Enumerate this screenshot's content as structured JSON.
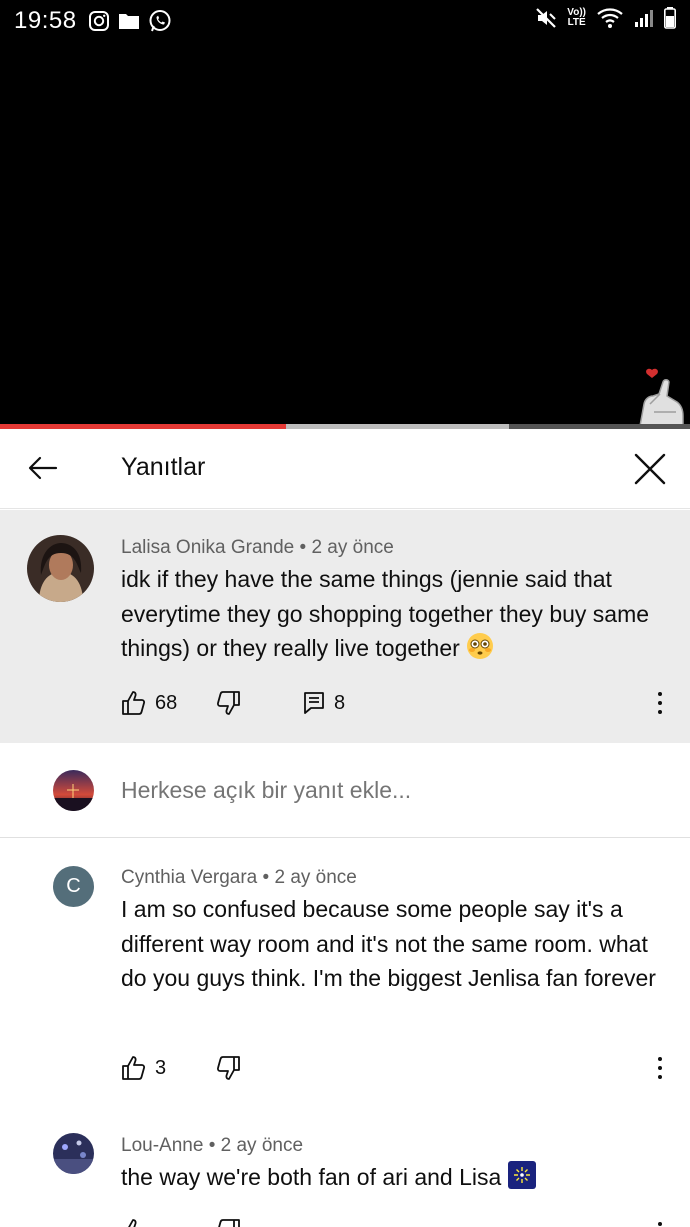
{
  "status_bar": {
    "time": "19:58",
    "lte_top": "Vo))",
    "lte_bottom": "LTE"
  },
  "video": {
    "played_fraction": 0.415,
    "buffered_fraction": 0.737
  },
  "panel": {
    "title": "Yanıtlar"
  },
  "parent_comment": {
    "author": "Lalisa Onika Grande",
    "time": "2 ay önce",
    "text": "idk if they have the same things (jennie said that everytime they go shopping together they buy same things) or they really live together",
    "likes": "68",
    "replies": "8"
  },
  "reply_input": {
    "placeholder": "Herkese açık bir yanıt ekle..."
  },
  "replies": [
    {
      "author": "Cynthia Vergara",
      "time": "2 ay önce",
      "avatar_letter": "C",
      "text": "I am so confused because some people say it's a different way room and it's not the same room. what do you guys think. I'm the biggest Jenlisa fan forever",
      "likes": "3"
    },
    {
      "author": "Lou-Anne",
      "time": "2 ay önce",
      "text": "the way we're both fan of ari and Lisa"
    }
  ],
  "meta_separator": "•",
  "colors": {
    "progress_played": "#e53935",
    "parent_bg": "#ececec",
    "secondary_text": "#606060",
    "letter_avatar_bg": "#546e7a"
  }
}
